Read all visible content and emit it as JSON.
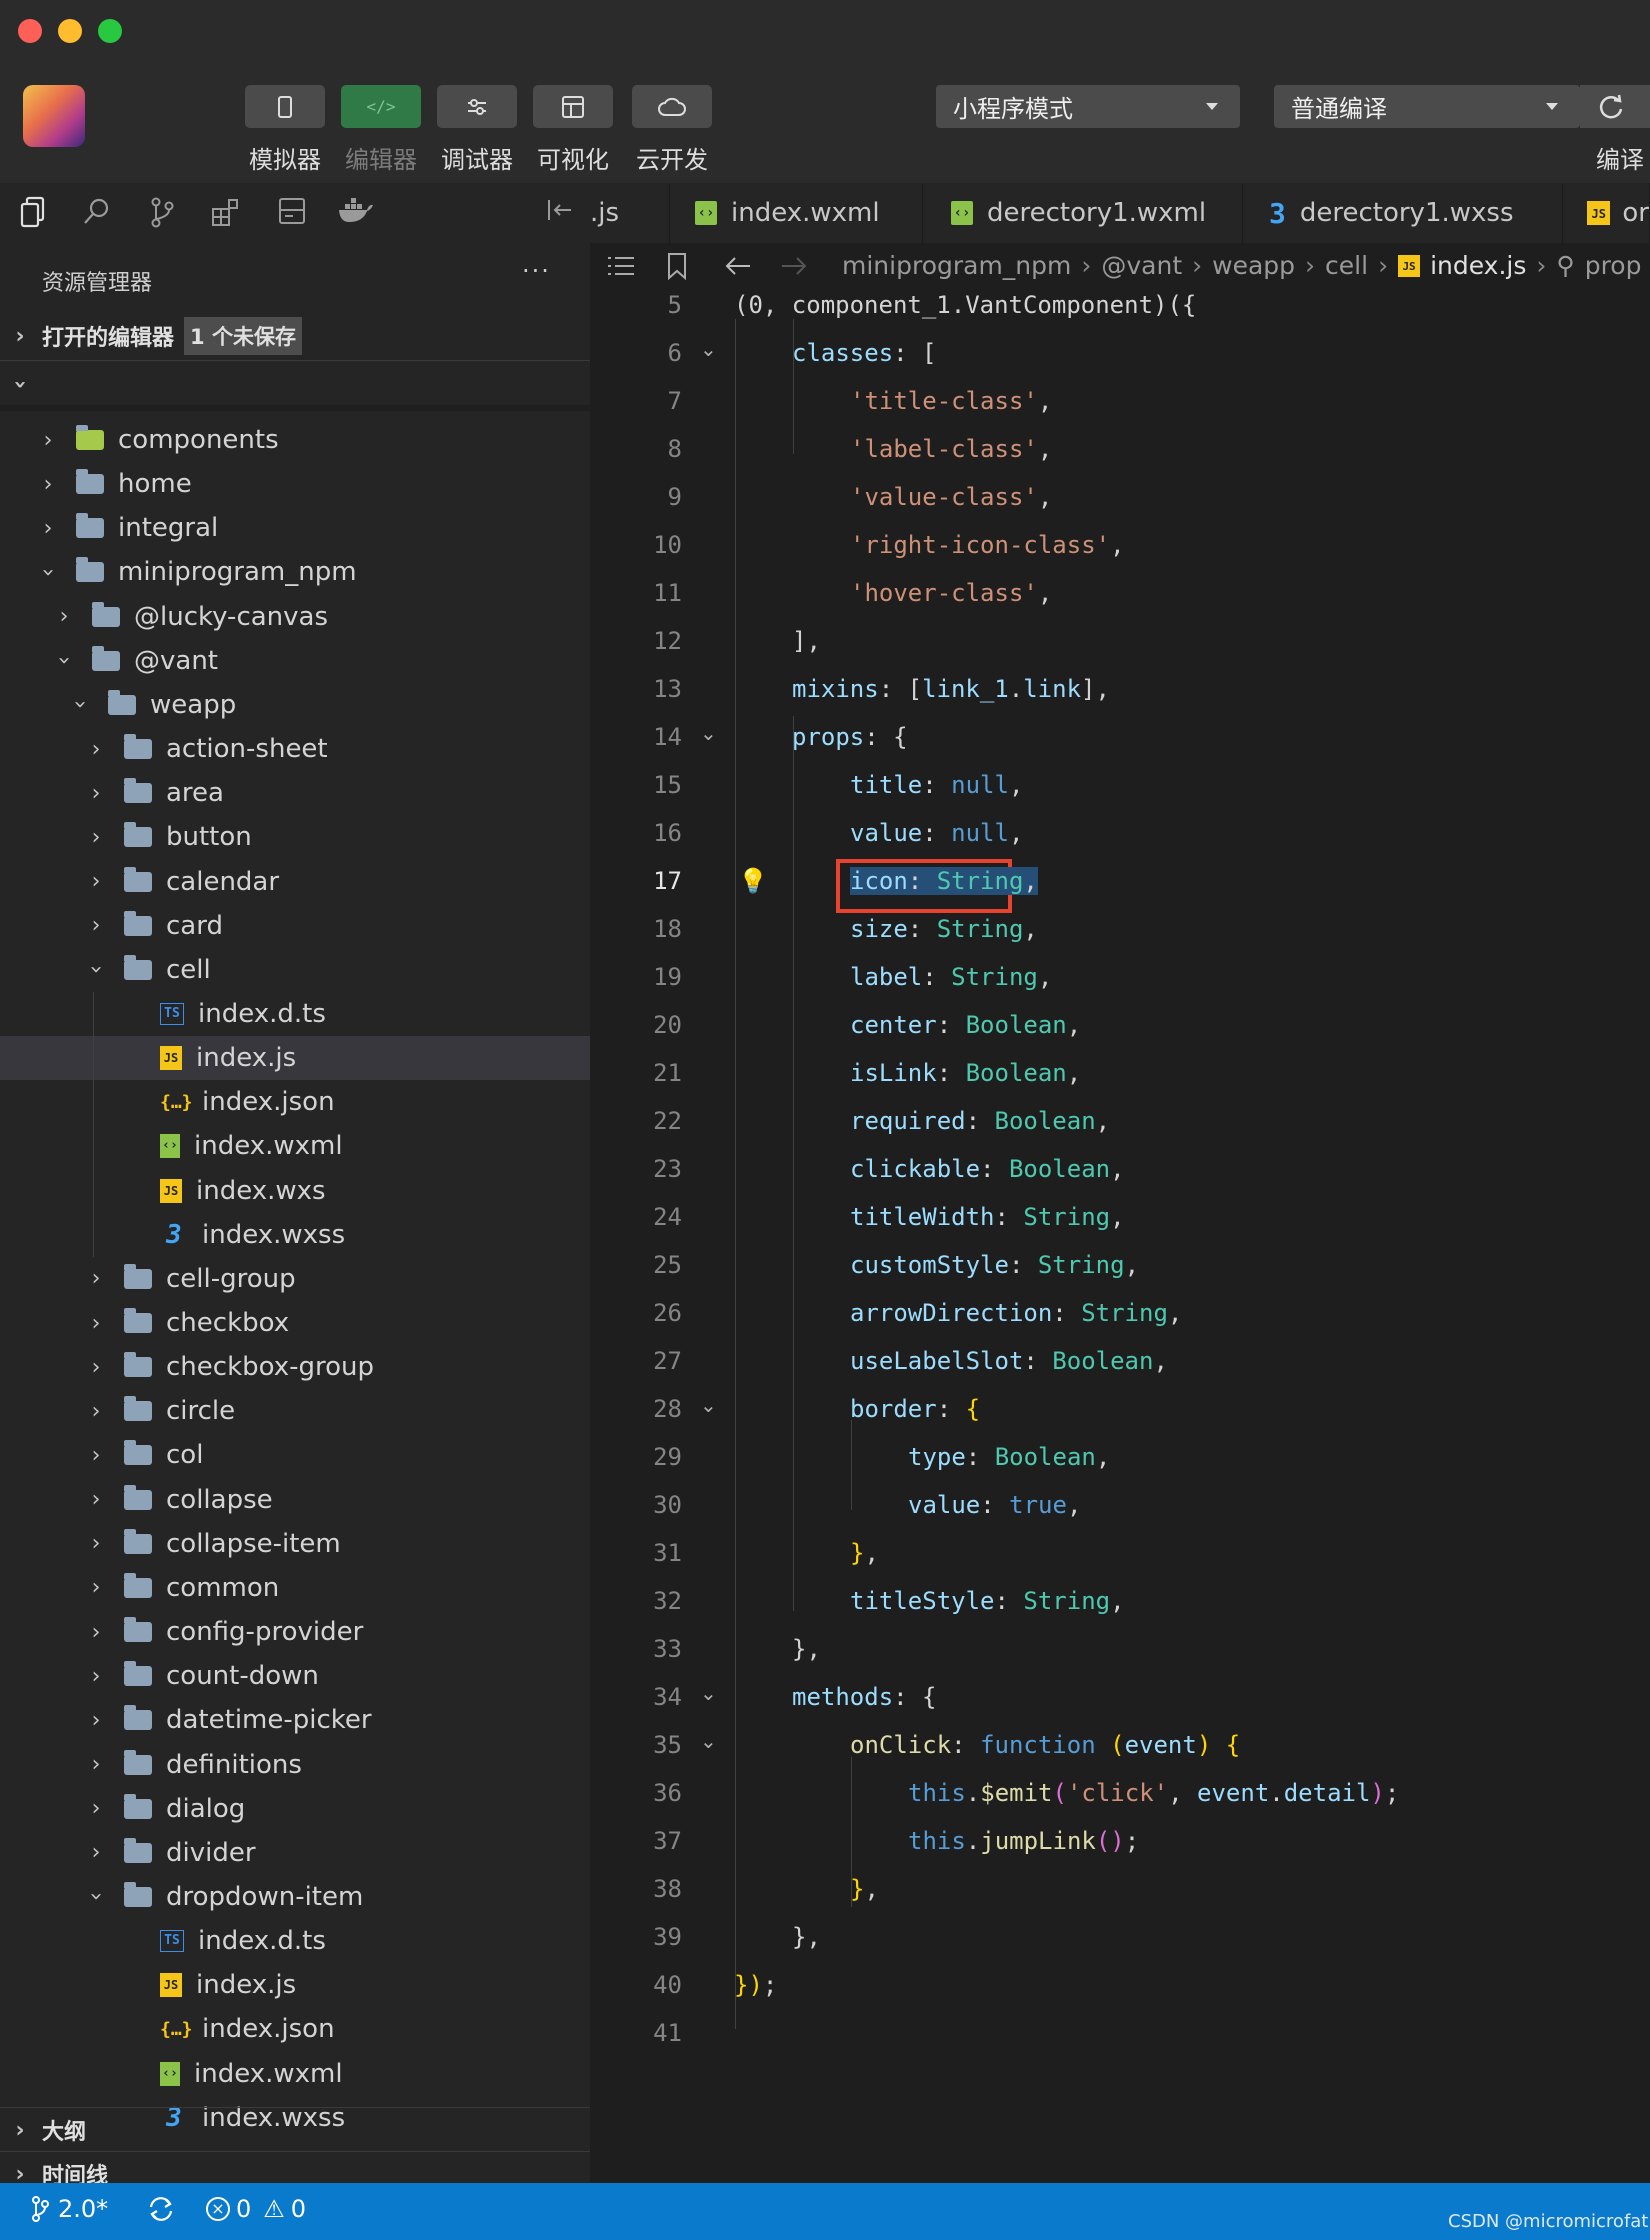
{
  "toolbar": {
    "buttons": [
      {
        "label": "模拟器",
        "icon": "phone-icon"
      },
      {
        "label": "编辑器",
        "icon": "code-icon"
      },
      {
        "label": "调试器",
        "icon": "debug-icon"
      },
      {
        "label": "可视化",
        "icon": "layout-icon"
      },
      {
        "label": "云开发",
        "icon": "cloud-icon"
      }
    ],
    "mode_select": "小程序模式",
    "compile_select": "普通编译",
    "compile_label": "编译"
  },
  "tabs": [
    {
      "label": ".js",
      "icon": ""
    },
    {
      "label": "index.wxml",
      "icon": "wxml-file-icon"
    },
    {
      "label": "derectory1.wxml",
      "icon": "wxml-file-icon"
    },
    {
      "label": "derectory1.wxss",
      "icon": "css-file-icon"
    },
    {
      "label": "or",
      "icon": "js-file-icon"
    }
  ],
  "sidebar": {
    "title": "资源管理器",
    "more": "···",
    "open_editors": "打开的编辑器",
    "unsaved_badge": "1 个未保存",
    "tree": [
      {
        "label": "components",
        "type": "folder",
        "depth": 0,
        "expanded": false
      },
      {
        "label": "home",
        "type": "folder",
        "depth": 0,
        "expanded": false
      },
      {
        "label": "integral",
        "type": "folder",
        "depth": 0,
        "expanded": false
      },
      {
        "label": "miniprogram_npm",
        "type": "folder",
        "depth": 0,
        "expanded": true
      },
      {
        "label": "@lucky-canvas",
        "type": "folder",
        "depth": 1,
        "expanded": false
      },
      {
        "label": "@vant",
        "type": "folder",
        "depth": 1,
        "expanded": true
      },
      {
        "label": "weapp",
        "type": "folder",
        "depth": 2,
        "expanded": true
      },
      {
        "label": "action-sheet",
        "type": "folder",
        "depth": 3,
        "expanded": false
      },
      {
        "label": "area",
        "type": "folder",
        "depth": 3,
        "expanded": false
      },
      {
        "label": "button",
        "type": "folder",
        "depth": 3,
        "expanded": false
      },
      {
        "label": "calendar",
        "type": "folder",
        "depth": 3,
        "expanded": false
      },
      {
        "label": "card",
        "type": "folder",
        "depth": 3,
        "expanded": false
      },
      {
        "label": "cell",
        "type": "folder",
        "depth": 3,
        "expanded": true
      },
      {
        "label": "index.d.ts",
        "type": "ts",
        "depth": 4
      },
      {
        "label": "index.js",
        "type": "js",
        "depth": 4,
        "selected": true
      },
      {
        "label": "index.json",
        "type": "json",
        "depth": 4
      },
      {
        "label": "index.wxml",
        "type": "wxml",
        "depth": 4
      },
      {
        "label": "index.wxs",
        "type": "js",
        "depth": 4
      },
      {
        "label": "index.wxss",
        "type": "css",
        "depth": 4
      },
      {
        "label": "cell-group",
        "type": "folder",
        "depth": 3,
        "expanded": false
      },
      {
        "label": "checkbox",
        "type": "folder",
        "depth": 3,
        "expanded": false
      },
      {
        "label": "checkbox-group",
        "type": "folder",
        "depth": 3,
        "expanded": false
      },
      {
        "label": "circle",
        "type": "folder",
        "depth": 3,
        "expanded": false
      },
      {
        "label": "col",
        "type": "folder",
        "depth": 3,
        "expanded": false
      },
      {
        "label": "collapse",
        "type": "folder",
        "depth": 3,
        "expanded": false
      },
      {
        "label": "collapse-item",
        "type": "folder",
        "depth": 3,
        "expanded": false
      },
      {
        "label": "common",
        "type": "folder",
        "depth": 3,
        "expanded": false
      },
      {
        "label": "config-provider",
        "type": "folder",
        "depth": 3,
        "expanded": false
      },
      {
        "label": "count-down",
        "type": "folder",
        "depth": 3,
        "expanded": false
      },
      {
        "label": "datetime-picker",
        "type": "folder",
        "depth": 3,
        "expanded": false
      },
      {
        "label": "definitions",
        "type": "folder",
        "depth": 3,
        "expanded": false
      },
      {
        "label": "dialog",
        "type": "folder",
        "depth": 3,
        "expanded": false
      },
      {
        "label": "divider",
        "type": "folder",
        "depth": 3,
        "expanded": false
      },
      {
        "label": "dropdown-item",
        "type": "folder",
        "depth": 3,
        "expanded": true
      },
      {
        "label": "index.d.ts",
        "type": "ts",
        "depth": 4
      },
      {
        "label": "index.js",
        "type": "js",
        "depth": 4
      },
      {
        "label": "index.json",
        "type": "json",
        "depth": 4
      },
      {
        "label": "index.wxml",
        "type": "wxml",
        "depth": 4
      },
      {
        "label": "index.wxss",
        "type": "css",
        "depth": 4
      }
    ],
    "outline": "大纲",
    "timeline": "时间线"
  },
  "breadcrumb": [
    "miniprogram_npm",
    "@vant",
    "weapp",
    "cell",
    "index.js",
    "prop"
  ],
  "code": {
    "current_line": 17,
    "lines": [
      {
        "n": "5",
        "indent": 0,
        "tokens": [
          {
            "t": "(0, component_1.VantComponent)({",
            "c": "plain"
          }
        ]
      },
      {
        "n": "6",
        "indent": 1,
        "fold": true,
        "tokens": [
          {
            "t": "classes",
            "c": "prop"
          },
          {
            "t": ": [",
            "c": "plain"
          }
        ]
      },
      {
        "n": "7",
        "indent": 2,
        "tokens": [
          {
            "t": "'title-class'",
            "c": "str"
          },
          {
            "t": ",",
            "c": "plain"
          }
        ]
      },
      {
        "n": "8",
        "indent": 2,
        "tokens": [
          {
            "t": "'label-class'",
            "c": "str"
          },
          {
            "t": ",",
            "c": "plain"
          }
        ]
      },
      {
        "n": "9",
        "indent": 2,
        "tokens": [
          {
            "t": "'value-class'",
            "c": "str"
          },
          {
            "t": ",",
            "c": "plain"
          }
        ]
      },
      {
        "n": "10",
        "indent": 2,
        "tokens": [
          {
            "t": "'right-icon-class'",
            "c": "str"
          },
          {
            "t": ",",
            "c": "plain"
          }
        ]
      },
      {
        "n": "11",
        "indent": 2,
        "tokens": [
          {
            "t": "'hover-class'",
            "c": "str"
          },
          {
            "t": ",",
            "c": "plain"
          }
        ]
      },
      {
        "n": "12",
        "indent": 1,
        "tokens": [
          {
            "t": "],",
            "c": "plain"
          }
        ]
      },
      {
        "n": "13",
        "indent": 1,
        "tokens": [
          {
            "t": "mixins",
            "c": "prop"
          },
          {
            "t": ": [",
            "c": "plain"
          },
          {
            "t": "link_1",
            "c": "prop"
          },
          {
            "t": ".",
            "c": "plain"
          },
          {
            "t": "link",
            "c": "prop"
          },
          {
            "t": "],",
            "c": "plain"
          }
        ]
      },
      {
        "n": "14",
        "indent": 1,
        "fold": true,
        "tokens": [
          {
            "t": "props",
            "c": "prop"
          },
          {
            "t": ": {",
            "c": "plain"
          }
        ]
      },
      {
        "n": "15",
        "indent": 2,
        "tokens": [
          {
            "t": "title",
            "c": "prop"
          },
          {
            "t": ": ",
            "c": "plain"
          },
          {
            "t": "null",
            "c": "kw"
          },
          {
            "t": ",",
            "c": "plain"
          }
        ]
      },
      {
        "n": "16",
        "indent": 2,
        "tokens": [
          {
            "t": "value",
            "c": "prop"
          },
          {
            "t": ": ",
            "c": "plain"
          },
          {
            "t": "null",
            "c": "kw"
          },
          {
            "t": ",",
            "c": "plain"
          }
        ]
      },
      {
        "n": "17",
        "indent": 2,
        "highlight": true,
        "tokens": [
          {
            "t": "icon",
            "c": "prop"
          },
          {
            "t": ": ",
            "c": "plain"
          },
          {
            "t": "String",
            "c": "type"
          },
          {
            "t": ",",
            "c": "plain"
          }
        ]
      },
      {
        "n": "18",
        "indent": 2,
        "tokens": [
          {
            "t": "size",
            "c": "prop"
          },
          {
            "t": ": ",
            "c": "plain"
          },
          {
            "t": "String",
            "c": "type"
          },
          {
            "t": ",",
            "c": "plain"
          }
        ]
      },
      {
        "n": "19",
        "indent": 2,
        "tokens": [
          {
            "t": "label",
            "c": "prop"
          },
          {
            "t": ": ",
            "c": "plain"
          },
          {
            "t": "String",
            "c": "type"
          },
          {
            "t": ",",
            "c": "plain"
          }
        ]
      },
      {
        "n": "20",
        "indent": 2,
        "tokens": [
          {
            "t": "center",
            "c": "prop"
          },
          {
            "t": ": ",
            "c": "plain"
          },
          {
            "t": "Boolean",
            "c": "type"
          },
          {
            "t": ",",
            "c": "plain"
          }
        ]
      },
      {
        "n": "21",
        "indent": 2,
        "tokens": [
          {
            "t": "isLink",
            "c": "prop"
          },
          {
            "t": ": ",
            "c": "plain"
          },
          {
            "t": "Boolean",
            "c": "type"
          },
          {
            "t": ",",
            "c": "plain"
          }
        ]
      },
      {
        "n": "22",
        "indent": 2,
        "tokens": [
          {
            "t": "required",
            "c": "prop"
          },
          {
            "t": ": ",
            "c": "plain"
          },
          {
            "t": "Boolean",
            "c": "type"
          },
          {
            "t": ",",
            "c": "plain"
          }
        ]
      },
      {
        "n": "23",
        "indent": 2,
        "tokens": [
          {
            "t": "clickable",
            "c": "prop"
          },
          {
            "t": ": ",
            "c": "plain"
          },
          {
            "t": "Boolean",
            "c": "type"
          },
          {
            "t": ",",
            "c": "plain"
          }
        ]
      },
      {
        "n": "24",
        "indent": 2,
        "tokens": [
          {
            "t": "titleWidth",
            "c": "prop"
          },
          {
            "t": ": ",
            "c": "plain"
          },
          {
            "t": "String",
            "c": "type"
          },
          {
            "t": ",",
            "c": "plain"
          }
        ]
      },
      {
        "n": "25",
        "indent": 2,
        "tokens": [
          {
            "t": "customStyle",
            "c": "prop"
          },
          {
            "t": ": ",
            "c": "plain"
          },
          {
            "t": "String",
            "c": "type"
          },
          {
            "t": ",",
            "c": "plain"
          }
        ]
      },
      {
        "n": "26",
        "indent": 2,
        "tokens": [
          {
            "t": "arrowDirection",
            "c": "prop"
          },
          {
            "t": ": ",
            "c": "plain"
          },
          {
            "t": "String",
            "c": "type"
          },
          {
            "t": ",",
            "c": "plain"
          }
        ]
      },
      {
        "n": "27",
        "indent": 2,
        "tokens": [
          {
            "t": "useLabelSlot",
            "c": "prop"
          },
          {
            "t": ": ",
            "c": "plain"
          },
          {
            "t": "Boolean",
            "c": "type"
          },
          {
            "t": ",",
            "c": "plain"
          }
        ]
      },
      {
        "n": "28",
        "indent": 2,
        "fold": true,
        "tokens": [
          {
            "t": "border",
            "c": "prop"
          },
          {
            "t": ": ",
            "c": "plain"
          },
          {
            "t": "{",
            "c": "brace"
          }
        ]
      },
      {
        "n": "29",
        "indent": 3,
        "tokens": [
          {
            "t": "type",
            "c": "prop"
          },
          {
            "t": ": ",
            "c": "plain"
          },
          {
            "t": "Boolean",
            "c": "type"
          },
          {
            "t": ",",
            "c": "plain"
          }
        ]
      },
      {
        "n": "30",
        "indent": 3,
        "tokens": [
          {
            "t": "value",
            "c": "prop"
          },
          {
            "t": ": ",
            "c": "plain"
          },
          {
            "t": "true",
            "c": "kw"
          },
          {
            "t": ",",
            "c": "plain"
          }
        ]
      },
      {
        "n": "31",
        "indent": 2,
        "tokens": [
          {
            "t": "}",
            "c": "brace"
          },
          {
            "t": ",",
            "c": "plain"
          }
        ]
      },
      {
        "n": "32",
        "indent": 2,
        "tokens": [
          {
            "t": "titleStyle",
            "c": "prop"
          },
          {
            "t": ": ",
            "c": "plain"
          },
          {
            "t": "String",
            "c": "type"
          },
          {
            "t": ",",
            "c": "plain"
          }
        ]
      },
      {
        "n": "33",
        "indent": 1,
        "tokens": [
          {
            "t": "},",
            "c": "plain"
          }
        ]
      },
      {
        "n": "34",
        "indent": 1,
        "fold": true,
        "tokens": [
          {
            "t": "methods",
            "c": "prop"
          },
          {
            "t": ": {",
            "c": "plain"
          }
        ]
      },
      {
        "n": "35",
        "indent": 2,
        "fold": true,
        "tokens": [
          {
            "t": "onClick",
            "c": "fn"
          },
          {
            "t": ": ",
            "c": "plain"
          },
          {
            "t": "function",
            "c": "kw"
          },
          {
            "t": " ",
            "c": "plain"
          },
          {
            "t": "(",
            "c": "brace"
          },
          {
            "t": "event",
            "c": "prop"
          },
          {
            "t": ")",
            "c": "brace"
          },
          {
            "t": " ",
            "c": "plain"
          },
          {
            "t": "{",
            "c": "brace"
          }
        ]
      },
      {
        "n": "36",
        "indent": 3,
        "tokens": [
          {
            "t": "this",
            "c": "kw"
          },
          {
            "t": ".",
            "c": "plain"
          },
          {
            "t": "$emit",
            "c": "fn"
          },
          {
            "t": "(",
            "c": "brace2"
          },
          {
            "t": "'click'",
            "c": "str"
          },
          {
            "t": ", ",
            "c": "plain"
          },
          {
            "t": "event",
            "c": "prop"
          },
          {
            "t": ".",
            "c": "plain"
          },
          {
            "t": "detail",
            "c": "prop"
          },
          {
            "t": ")",
            "c": "brace2"
          },
          {
            "t": ";",
            "c": "plain"
          }
        ]
      },
      {
        "n": "37",
        "indent": 3,
        "tokens": [
          {
            "t": "this",
            "c": "kw"
          },
          {
            "t": ".",
            "c": "plain"
          },
          {
            "t": "jumpLink",
            "c": "fn"
          },
          {
            "t": "()",
            "c": "brace2"
          },
          {
            "t": ";",
            "c": "plain"
          }
        ]
      },
      {
        "n": "38",
        "indent": 2,
        "tokens": [
          {
            "t": "}",
            "c": "brace"
          },
          {
            "t": ",",
            "c": "plain"
          }
        ]
      },
      {
        "n": "39",
        "indent": 1,
        "tokens": [
          {
            "t": "},",
            "c": "plain"
          }
        ]
      },
      {
        "n": "40",
        "indent": 0,
        "tokens": [
          {
            "t": "})",
            "c": "brace"
          },
          {
            "t": ";",
            "c": "plain"
          }
        ]
      },
      {
        "n": "41",
        "indent": 0,
        "tokens": []
      }
    ]
  },
  "status": {
    "branch": "2.0*",
    "errors": "0",
    "warnings": "0",
    "watermark": "CSDN @micromicrofat"
  },
  "colors": {
    "prop": "#9cdcfe",
    "str": "#ce9178",
    "kw": "#569cd6",
    "type": "#4ec9b0",
    "fn": "#dcdcaa",
    "plain": "#d4d4d4",
    "brace": "#ffd700",
    "brace2": "#da70d6",
    "statusbar": "#0a7acc",
    "highlight_box": "#e8432e"
  }
}
